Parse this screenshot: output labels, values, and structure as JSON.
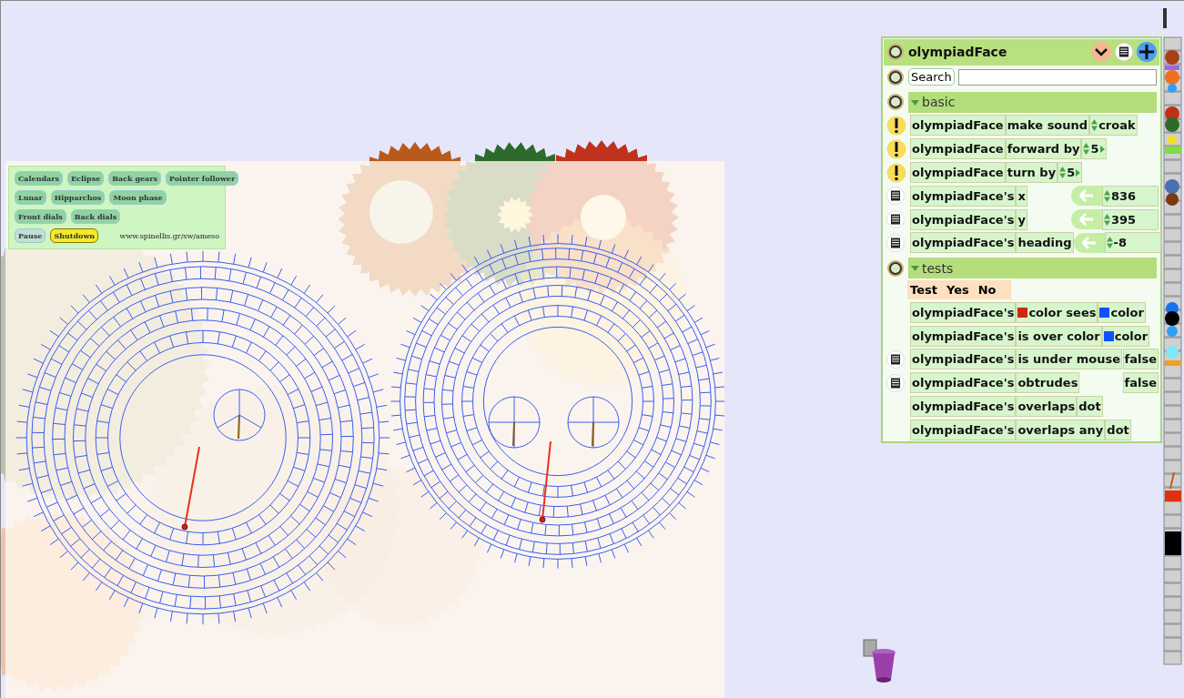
{
  "control_panel": {
    "button_rows": [
      [
        {
          "label": "Calendars",
          "color": "#8fd3a4"
        },
        {
          "label": "Eclipse",
          "color": "#8fd3a4"
        },
        {
          "label": "Back gears",
          "color": "#8fd3a4"
        },
        {
          "label": "Pointer follower",
          "color": "#8fd3a4"
        }
      ],
      [
        {
          "label": "Lunar",
          "color": "#8fd3a4"
        },
        {
          "label": "Hipparchos",
          "color": "#8fd3a4"
        },
        {
          "label": "Moon phase",
          "color": "#8fd3a4"
        }
      ],
      [
        {
          "label": "Front dials",
          "color": "#8fd3a4"
        },
        {
          "label": "Back dials",
          "color": "#8fd3a4"
        }
      ],
      [
        {
          "label": "Pause",
          "color": "#bfe0d8"
        },
        {
          "label": "Shutdown",
          "color": "#f4ea2a"
        }
      ]
    ],
    "url": "www.spinellis.gr/sw/ameso"
  },
  "viewer": {
    "title": "olympiadFace",
    "search_label": "Search",
    "categories": [
      {
        "name": "basic",
        "expanded": true,
        "rows": [
          {
            "kind": "command",
            "object": "olympiadFace",
            "phrase": "make sound",
            "argument": "croak",
            "stepper": false
          },
          {
            "kind": "command",
            "object": "olympiadFace",
            "phrase": "forward by",
            "argument": "5",
            "stepper": true
          },
          {
            "kind": "command",
            "object": "olympiadFace",
            "phrase": "turn by",
            "argument": "5",
            "stepper": true
          },
          {
            "kind": "getter",
            "object": "olympiadFace's",
            "phrase": "x",
            "value": "836",
            "assignable": true
          },
          {
            "kind": "getter",
            "object": "olympiadFace's",
            "phrase": "y",
            "value": "395",
            "assignable": true
          },
          {
            "kind": "getter",
            "object": "olympiadFace's",
            "phrase": "heading",
            "value": "-8",
            "assignable": true
          }
        ]
      },
      {
        "name": "tests",
        "expanded": true,
        "test_tile": [
          "Test",
          "Yes",
          "No"
        ],
        "rows": [
          {
            "kind": "test",
            "object": "olympiadFace's",
            "tiles": [
              {
                "text": "color sees",
                "color": "#cc2a10"
              },
              {
                "text": "color",
                "color": "#1050ff"
              }
            ]
          },
          {
            "kind": "test",
            "object": "olympiadFace's",
            "tiles": [
              {
                "text": "is over color"
              },
              {
                "text": "color",
                "color": "#1050ff"
              }
            ]
          },
          {
            "kind": "getter",
            "object": "olympiadFace's",
            "phrase": "is under mouse",
            "value": "false",
            "assignable": false
          },
          {
            "kind": "getter",
            "object": "olympiadFace's",
            "phrase": "obtrudes",
            "value": "false",
            "assignable": false
          },
          {
            "kind": "test",
            "object": "olympiadFace's",
            "tiles": [
              {
                "text": "overlaps"
              },
              {
                "text": "dot"
              }
            ]
          },
          {
            "kind": "test",
            "object": "olympiadFace's",
            "tiles": [
              {
                "text": "overlaps any"
              },
              {
                "text": "dot"
              }
            ]
          }
        ]
      }
    ]
  }
}
